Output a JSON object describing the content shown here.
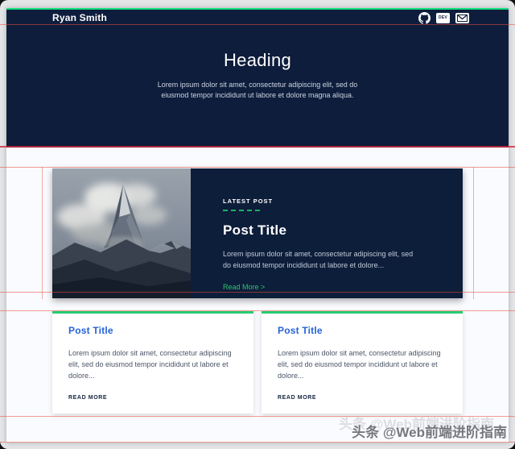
{
  "navbar": {
    "brand": "Ryan Smith",
    "dev_badge_label": "DEV",
    "icons": [
      "github",
      "dev",
      "mail"
    ]
  },
  "hero": {
    "title": "Heading",
    "subtitle": "Lorem ipsum dolor sit amet, consectetur adipiscing elit, sed do eiusmod tempor incididunt ut labore et dolore magna aliqua."
  },
  "featured": {
    "eyebrow": "LATEST POST",
    "title": "Post Title",
    "excerpt": "Lorem ipsum dolor sit amet, consectetur adipiscing elit, sed do eiusmod tempor incididunt ut labore et dolore...",
    "read_more": "Read More >",
    "image_alt": "mountain-peak-photo"
  },
  "posts": [
    {
      "title": "Post Title",
      "excerpt": "Lorem ipsum dolor sit amet, consectetur adipiscing elit, sed do eiusmod tempor incididunt ut labore et dolore...",
      "read_more": "READ MORE"
    },
    {
      "title": "Post Title",
      "excerpt": "Lorem ipsum dolor sit amet, consectetur adipiscing elit, sed do eiusmod tempor incididunt ut labore et dolore...",
      "read_more": "READ MORE"
    }
  ],
  "watermark": "头条 @Web前端进阶指南",
  "colors": {
    "navy": "#0e1d3c",
    "accent_green_bright": "#14e07d",
    "accent_green": "#26cd74",
    "link_green": "#2fc176",
    "title_blue": "#2563d8",
    "debug_red": "#e74c3c",
    "page_bg": "#fafbfe",
    "outer_bg": "#e4e5e7"
  }
}
